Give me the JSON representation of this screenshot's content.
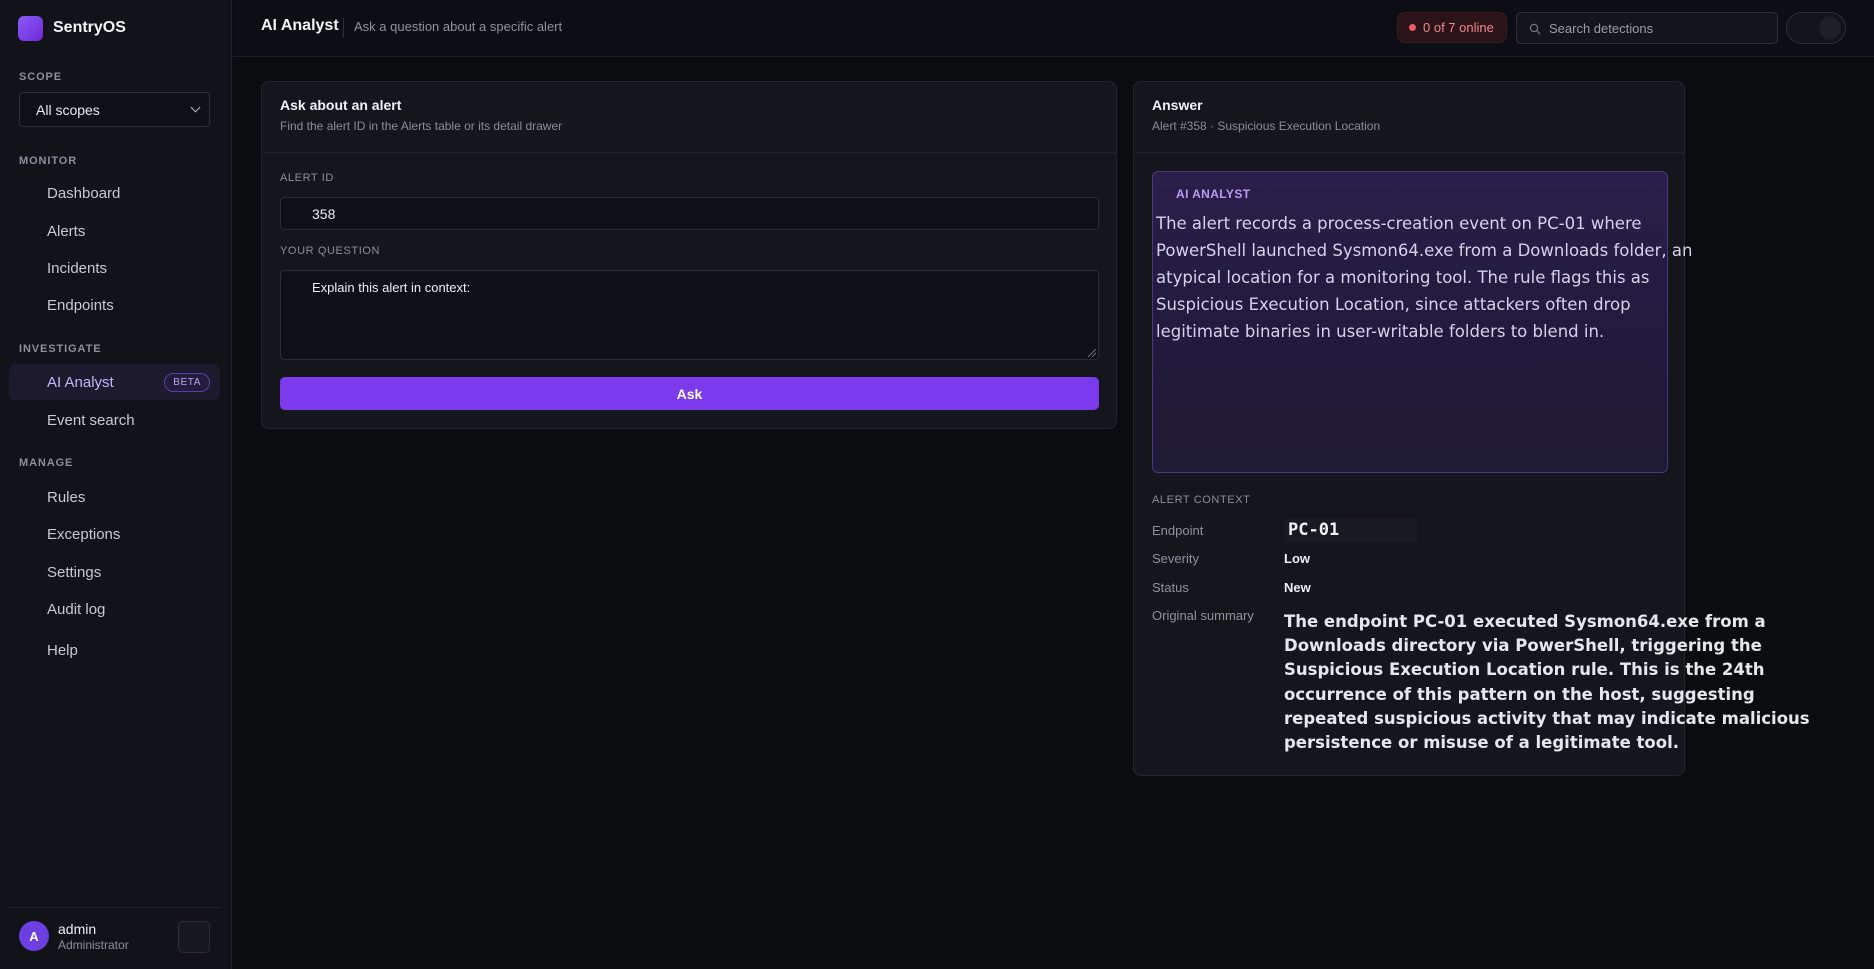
{
  "app": {
    "name": "SentryOS"
  },
  "sidebar": {
    "scope_label": "SCOPE",
    "scope_value": "All scopes",
    "sections": {
      "monitor": "MONITOR",
      "investigate": "INVESTIGATE",
      "manage": "MANAGE"
    },
    "items": {
      "dashboard": "Dashboard",
      "alerts": "Alerts",
      "incidents": "Incidents",
      "endpoints": "Endpoints",
      "ai_analyst": "AI Analyst",
      "ai_analyst_badge": "BETA",
      "event_search": "Event search",
      "rules": "Rules",
      "exceptions": "Exceptions",
      "settings": "Settings",
      "audit_log": "Audit log",
      "help": "Help"
    },
    "user": {
      "initial": "A",
      "name": "admin",
      "role": "Administrator"
    }
  },
  "header": {
    "title": "AI Analyst",
    "subtitle": "Ask a question about a specific alert",
    "online_status": "0 of 7 online",
    "search_placeholder": "Search detections"
  },
  "ask_card": {
    "title": "Ask about an alert",
    "subtitle": "Find the alert ID in the Alerts table or its detail drawer",
    "alert_id_label": "ALERT ID",
    "alert_id_value": "358",
    "question_label": "YOUR QUESTION",
    "question_value": "Explain this alert in context:",
    "ask_button": "Ask"
  },
  "answer_card": {
    "title": "Answer",
    "subtitle": "Alert #358 · Suspicious Execution Location",
    "ai_label": "AI ANALYST",
    "ai_text": "The alert records a process-creation event on PC-01 where PowerShell launched Sysmon64.exe from a Downloads folder, an atypical location for a monitoring tool. The rule flags this as Suspicious Execution Location, since attackers often drop legitimate binaries in user-writable folders to blend in.",
    "context_label": "ALERT CONTEXT",
    "context": {
      "endpoint_key": "Endpoint",
      "endpoint_value": "PC-01",
      "severity_key": "Severity",
      "severity_value": "Low",
      "status_key": "Status",
      "status_value": "New",
      "summary_key": "Original summary",
      "summary_value": "The endpoint PC-01 executed Sysmon64.exe from a Downloads directory via PowerShell, triggering the Suspicious Execution Location rule. This is the 24th occurrence of this pattern on the host, suggesting repeated suspicious activity that may indicate malicious persistence or misuse of a legitimate tool."
    }
  },
  "colors": {
    "accent": "#7c3aed",
    "background": "#0b0c10",
    "offline": "#f05a68"
  }
}
